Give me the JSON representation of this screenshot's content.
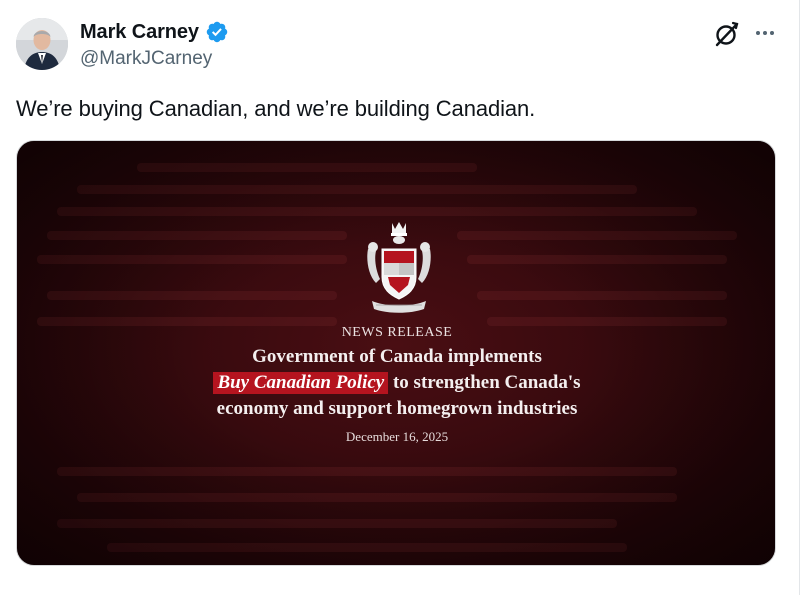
{
  "post": {
    "author": {
      "name": "Mark Carney",
      "handle": "@MarkJCarney",
      "verified": true,
      "avatar_icon": "avatar-photo"
    },
    "text": "We’re buying Canadian, and we’re building Canadian.",
    "actions": {
      "grok_icon": "grok-icon",
      "more_icon": "more-options-icon"
    },
    "media": {
      "emblem": "coat-of-arms-of-canada",
      "label": "NEWS RELEASE",
      "headline_line1": "Government of Canada implements",
      "headline_highlight": "Buy Canadian Policy",
      "headline_line2_rest": " to strengthen Canada's",
      "headline_line3": "economy and support homegrown industries",
      "date": "December 16, 2025"
    }
  },
  "colors": {
    "verified_badge": "#1d9bf0",
    "handle": "#536471",
    "media_background": "#3a0a0f",
    "highlight": "#b5141f"
  }
}
